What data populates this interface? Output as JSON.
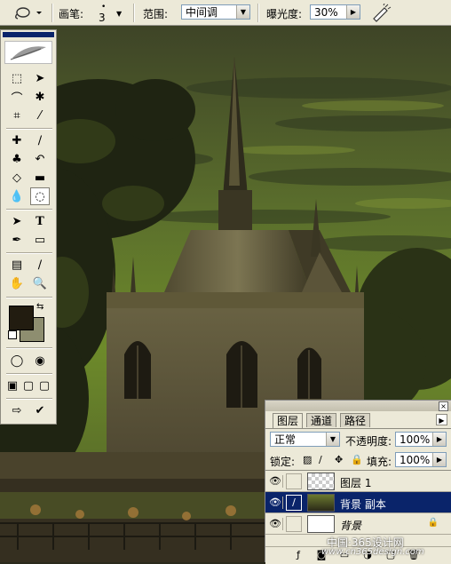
{
  "options_bar": {
    "brush_label": "画笔:",
    "brush_size": "3",
    "range_label": "范围:",
    "range_value": "中间调",
    "exposure_label": "曝光度:",
    "exposure_value": "30%"
  },
  "toolbox": {
    "active_tool": "burn-tool",
    "foreground_color": "#221c10",
    "background_color": "#8e8e70",
    "type_tool_glyph": "T"
  },
  "layers_panel": {
    "tabs": [
      "图层",
      "通道",
      "路径"
    ],
    "blend_mode": "正常",
    "opacity_label": "不透明度:",
    "opacity_value": "100%",
    "lock_label": "锁定:",
    "fill_label": "填充:",
    "fill_value": "100%",
    "layers": [
      {
        "name": "图层 1",
        "visible": true,
        "selected": false
      },
      {
        "name": "背景 副本",
        "visible": true,
        "selected": true
      },
      {
        "name": "背景",
        "visible": true,
        "selected": false,
        "locked": true
      }
    ]
  },
  "watermark": {
    "line1": "中国·365设计网",
    "line2": "www.cn365design.com"
  }
}
